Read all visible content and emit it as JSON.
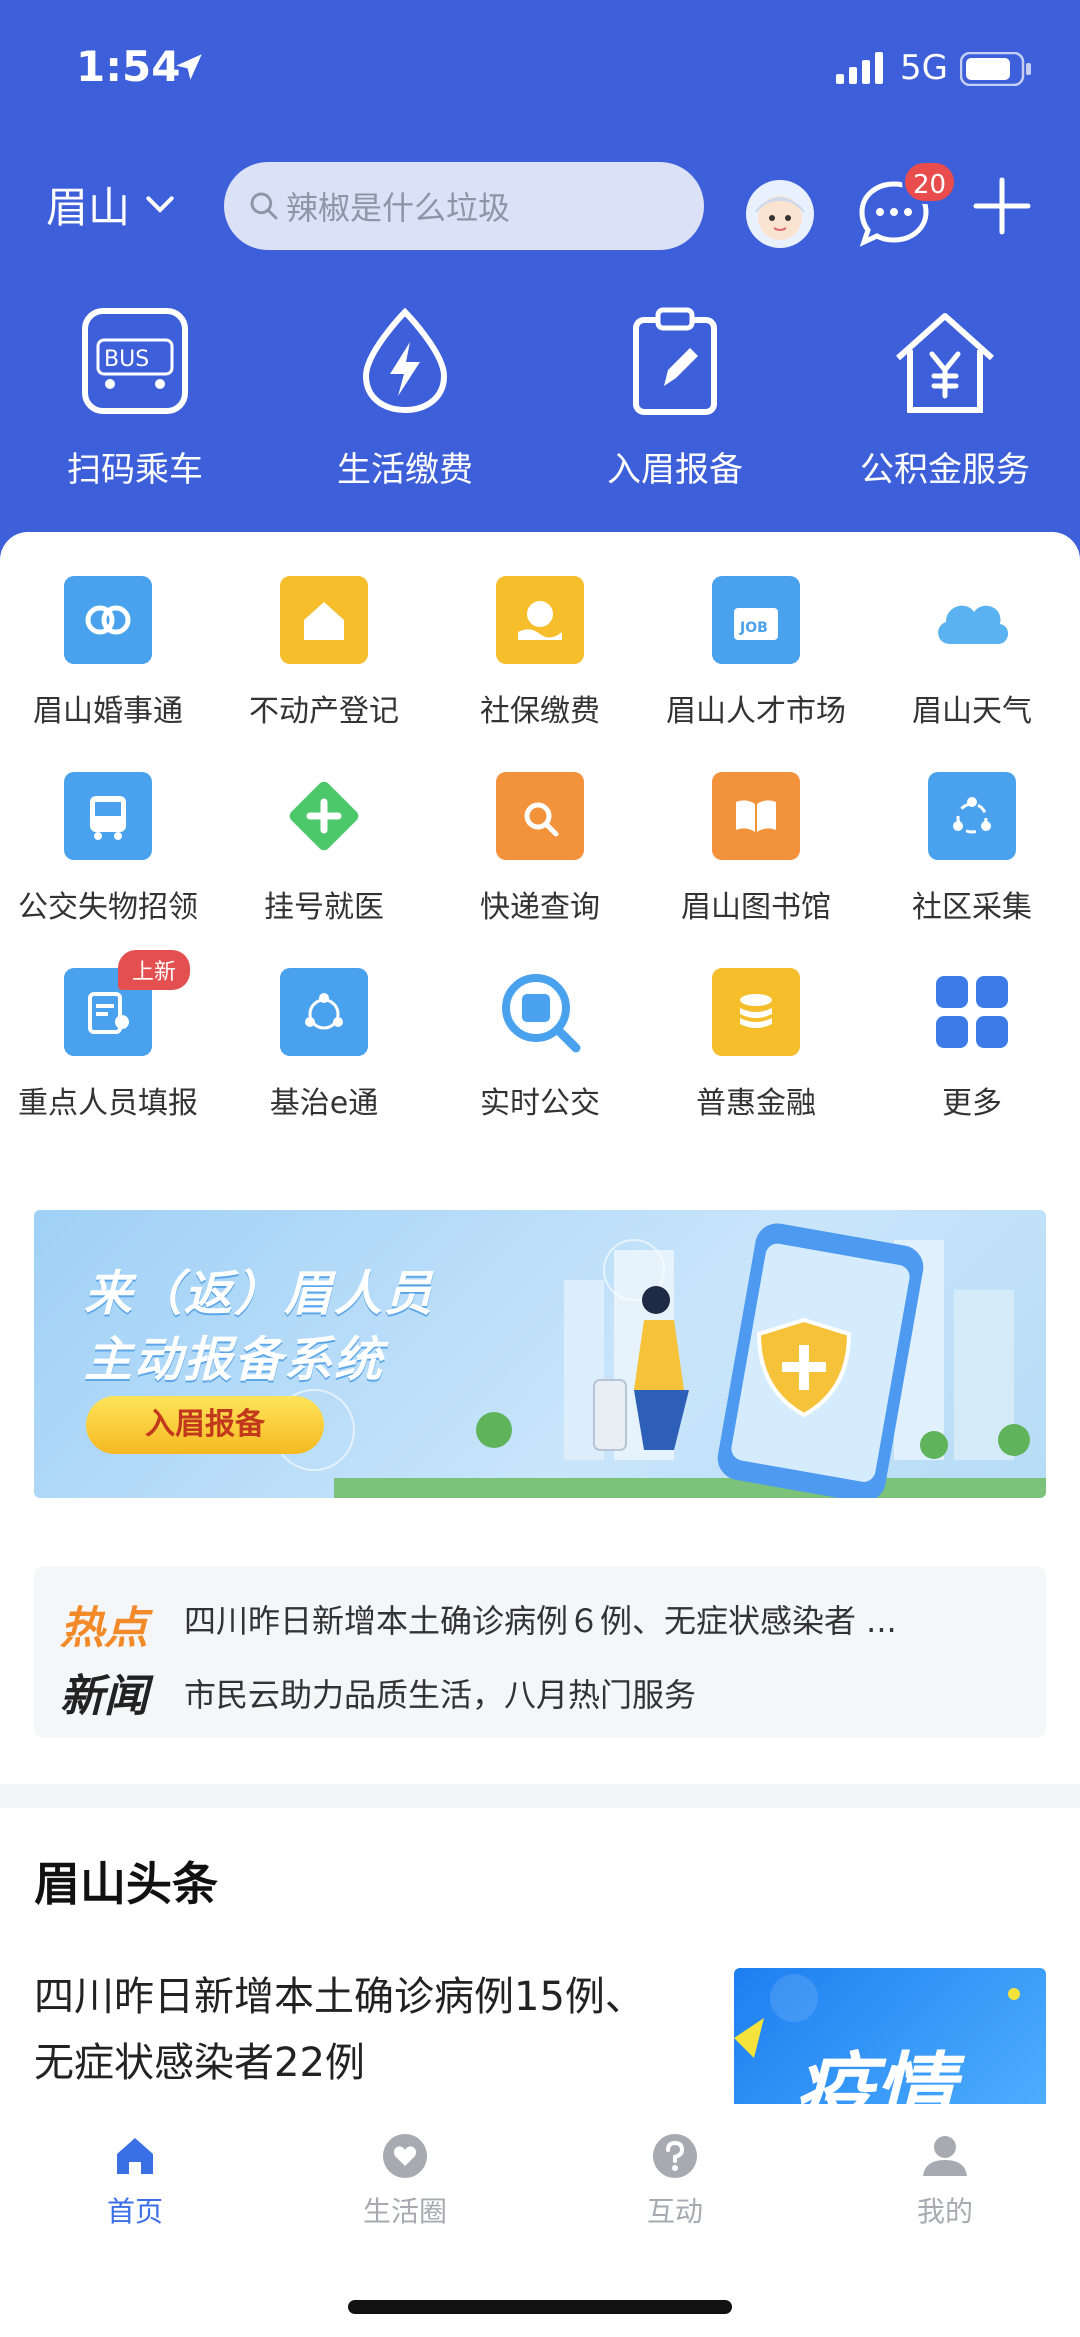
{
  "status": {
    "time": "1:54",
    "network": "5G"
  },
  "header": {
    "city": "眉山",
    "search_placeholder": "辣椒是什么垃圾",
    "message_badge": "20"
  },
  "quick_actions": [
    {
      "label": "扫码乘车",
      "icon": "bus-qr-icon"
    },
    {
      "label": "生活缴费",
      "icon": "bolt-drop-icon"
    },
    {
      "label": "入眉报备",
      "icon": "clipboard-pen-icon"
    },
    {
      "label": "公积金服务",
      "icon": "house-yen-icon"
    }
  ],
  "services": [
    {
      "label": "眉山婚事通",
      "color": "#4aa2ee"
    },
    {
      "label": "不动产登记",
      "color": "#f6be2b"
    },
    {
      "label": "社保缴费",
      "color": "#f6be2b"
    },
    {
      "label": "眉山人才市场",
      "color": "#4aa2ee"
    },
    {
      "label": "眉山天气",
      "color": "#5ab2f0"
    },
    {
      "label": "公交失物招领",
      "color": "#4aa2ee"
    },
    {
      "label": "挂号就医",
      "color": "#4cc76a"
    },
    {
      "label": "快递查询",
      "color": "#f2923a"
    },
    {
      "label": "眉山图书馆",
      "color": "#f2923a"
    },
    {
      "label": "社区采集",
      "color": "#4aa2ee"
    },
    {
      "label": "重点人员填报",
      "color": "#4aa2ee",
      "tag": "上新"
    },
    {
      "label": "基治e通",
      "color": "#4aa2ee"
    },
    {
      "label": "实时公交",
      "color": "#4aa2ee"
    },
    {
      "label": "普惠金融",
      "color": "#f6be2b"
    },
    {
      "label": "更多",
      "color": "#3d7ce8"
    }
  ],
  "banner": {
    "line1": "来（返）眉人员",
    "line2": "主动报备系统",
    "button": "入眉报备"
  },
  "hot_news": {
    "tag_top": "热点",
    "tag_bottom": "新闻",
    "items": [
      "四川昨日新增本土确诊病例６例、无症状感染者 ...",
      "市民云助力品质生活，八月热门服务"
    ]
  },
  "headlines": {
    "title": "眉山头条",
    "article_title": "四川昨日新增本土确诊病例15例、无症状感染者22例",
    "thumb_text": "疫情"
  },
  "tabbar": [
    {
      "label": "首页",
      "active": true
    },
    {
      "label": "生活圈",
      "active": false
    },
    {
      "label": "互动",
      "active": false
    },
    {
      "label": "我的",
      "active": false
    }
  ],
  "colors": {
    "brand": "#3d5fd9",
    "tab_active": "#3b6fe6",
    "badge": "#e84c4c"
  }
}
